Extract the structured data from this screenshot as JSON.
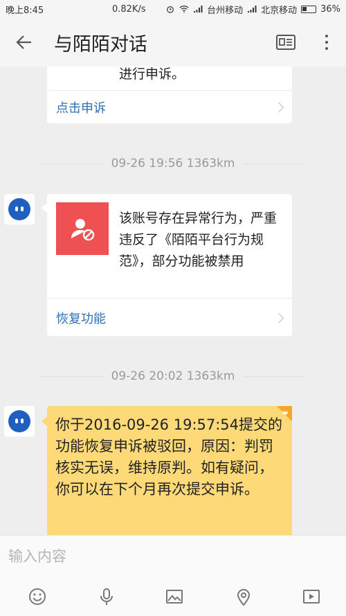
{
  "status": {
    "time": "晚上8:45",
    "speed": "0.82K/s",
    "carrier1": "台州移动",
    "carrier2": "北京移动",
    "battery": "36%"
  },
  "header": {
    "title": "与陌陌对话"
  },
  "messages": {
    "prev_card_text": "进行申诉。",
    "prev_card_link": "点击申诉",
    "ts1": "09-26 19:56  1363km",
    "ban_text": "该账号存在异常行为，严重违反了《陌陌平台行为规范》，部分功能被禁用",
    "ban_link": "恢复功能",
    "ts2": "09-26 20:02  1363km",
    "notice_text": "你于2016-09-26 19:57:54提交的功能恢复申诉被驳回，原因：判罚核实无误，维持原判。如有疑问，你可以在下个月再次提交申诉。"
  },
  "input": {
    "placeholder": "输入内容"
  },
  "colors": {
    "accent": "#2f6fb6",
    "notice_bg": "#fdd978",
    "ban_red": "#ef5052",
    "avatar_blue": "#1f5fbf"
  },
  "icons": {
    "back": "arrow-left-icon",
    "profile": "profile-card-icon",
    "more": "more-vertical-icon",
    "emoji": "emoji-icon",
    "mic": "microphone-icon",
    "image": "image-icon",
    "location": "location-icon",
    "video": "video-icon"
  }
}
